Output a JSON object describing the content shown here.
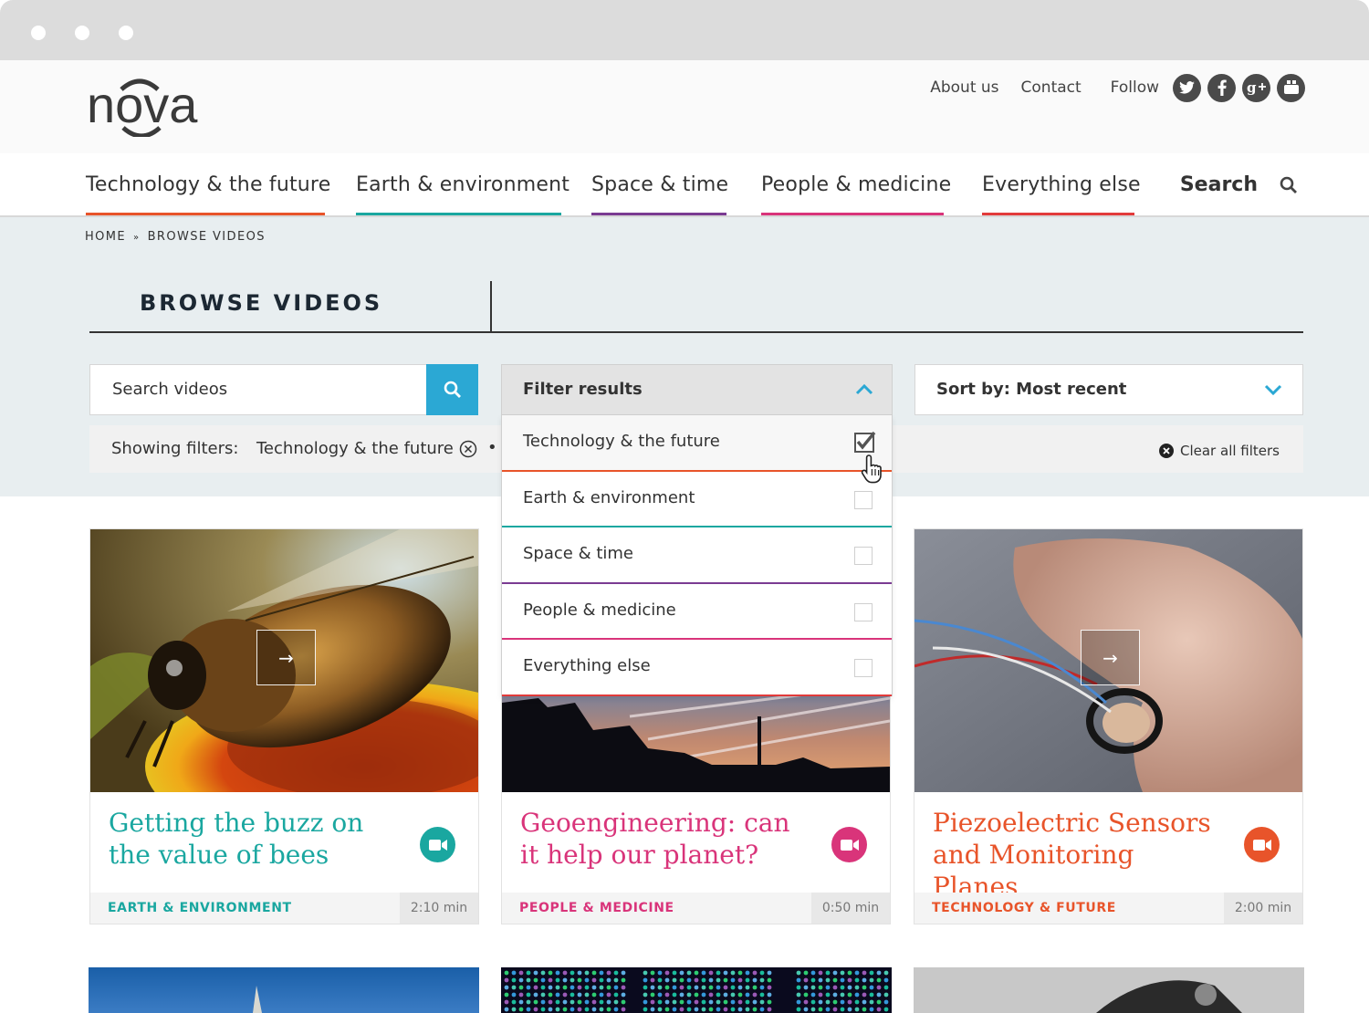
{
  "header": {
    "logo_text": "nova",
    "links": [
      "About us",
      "Contact"
    ],
    "follow_label": "Follow",
    "social_icons": [
      "twitter-icon",
      "facebook-icon",
      "google-plus-icon",
      "youtube-icon"
    ]
  },
  "nav": {
    "items": [
      {
        "label": "Technology & the future",
        "color": "#e8542a"
      },
      {
        "label": "Earth & environment",
        "color": "#1aa7a0"
      },
      {
        "label": "Space & time",
        "color": "#7a3b92"
      },
      {
        "label": "People & medicine",
        "color": "#d9347a"
      },
      {
        "label": "Everything else",
        "color": "#e23b3b"
      }
    ],
    "search_label": "Search"
  },
  "breadcrumb": {
    "home": "HOME",
    "separator": "»",
    "current": "BROWSE VIDEOS"
  },
  "page_title": "BROWSE VIDEOS",
  "search": {
    "placeholder": "Search videos"
  },
  "sort": {
    "label": "Sort by: Most recent"
  },
  "filters": {
    "showing_label": "Showing filters:",
    "active_filter": "Technology & the future",
    "bullet": "•",
    "clear_label": "Clear all filters"
  },
  "filter_dropdown": {
    "title": "Filter results",
    "options": [
      {
        "label": "Technology & the future",
        "checked": true,
        "color": "#e8542a"
      },
      {
        "label": "Earth & environment",
        "checked": false,
        "color": "#1aa7a0"
      },
      {
        "label": "Space & time",
        "checked": false,
        "color": "#7a3b92"
      },
      {
        "label": "People & medicine",
        "checked": false,
        "color": "#d9347a"
      },
      {
        "label": "Everything else",
        "checked": false,
        "color": "#e23b3b"
      }
    ]
  },
  "cards": [
    {
      "title": "Getting the buzz on the value of bees",
      "category": "EARTH & ENVIRONMENT",
      "duration": "2:10 min",
      "color": "#1aa7a0"
    },
    {
      "title": "Geoengineering: can it help our planet?",
      "category": "PEOPLE & MEDICINE",
      "duration": "0:50 min",
      "color": "#d9347a"
    },
    {
      "title": "Piezoelectric Sensors and Monitoring Planes",
      "category": "TECHNOLOGY & FUTURE",
      "duration": "2:00 min",
      "color": "#e8542a"
    }
  ],
  "play_arrow": "→"
}
